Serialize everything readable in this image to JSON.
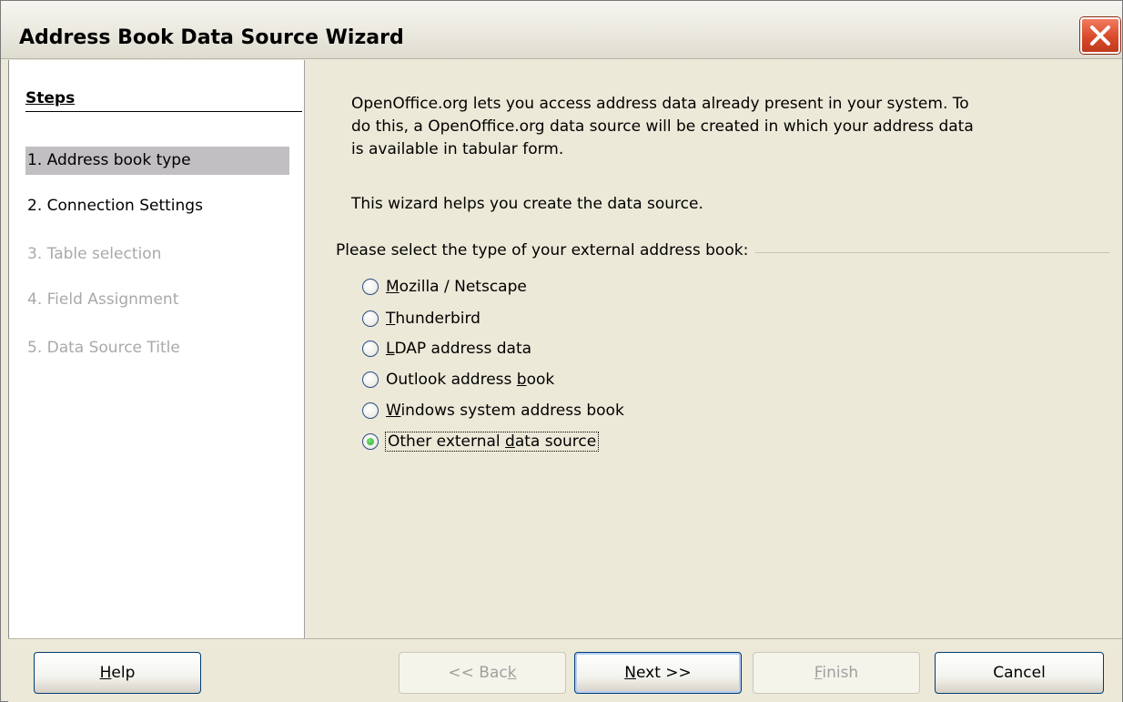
{
  "window": {
    "title": "Address Book Data Source Wizard"
  },
  "steps": {
    "heading": "Steps",
    "items": [
      {
        "label": "1. Address book type",
        "state": "active"
      },
      {
        "label": "2. Connection Settings",
        "state": "enabled"
      },
      {
        "label": "3. Table selection",
        "state": "disabled"
      },
      {
        "label": "4. Field Assignment",
        "state": "disabled"
      },
      {
        "label": "5. Data Source Title",
        "state": "disabled"
      }
    ]
  },
  "main": {
    "intro_lines": [
      "OpenOffice.org lets you access address data already present in your system. To",
      "do this, a OpenOffice.org data source will be created in which your address data",
      "is available in tabular form."
    ],
    "intro2": "This wizard helps you create the data source.",
    "group_label": "Please select the type of your external address book:",
    "options": [
      {
        "pre": "",
        "accel": "M",
        "post": "ozilla / Netscape",
        "checked": false
      },
      {
        "pre": "",
        "accel": "T",
        "post": "hunderbird",
        "checked": false
      },
      {
        "pre": "",
        "accel": "L",
        "post": "DAP address data",
        "checked": false
      },
      {
        "pre": "Outlook address ",
        "accel": "b",
        "post": "ook",
        "checked": false
      },
      {
        "pre": "",
        "accel": "W",
        "post": "indows system address book",
        "checked": false
      },
      {
        "pre": "Other external ",
        "accel": "d",
        "post": "ata source",
        "checked": true
      }
    ]
  },
  "buttons": {
    "help": {
      "accel": "H",
      "post": "elp"
    },
    "back": {
      "pre": "<< Bac",
      "accel": "k",
      "post": ""
    },
    "next": {
      "accel": "N",
      "post": "ext >>"
    },
    "finish": {
      "accel": "F",
      "post": "inish"
    },
    "cancel": {
      "label": "Cancel"
    }
  }
}
